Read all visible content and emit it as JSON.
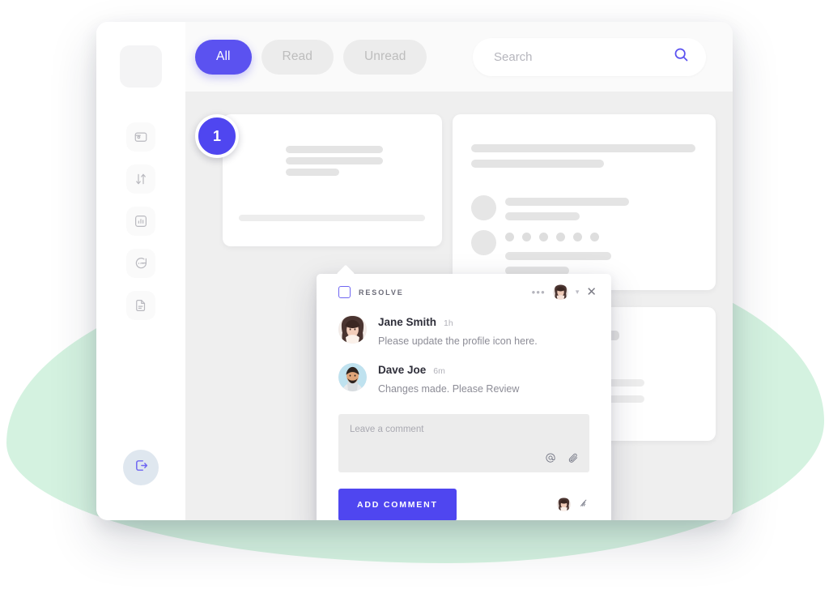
{
  "theme": {
    "accent": "#5b52f0",
    "accent_dark": "#4f46f0",
    "blob_green": "#d4f2e0",
    "canvas_gray": "#efefef",
    "skeleton_gray": "#e4e4e4"
  },
  "sidebar": {
    "logo_name": "app-logo-placeholder",
    "items": [
      {
        "icon": "wallet-icon"
      },
      {
        "icon": "transfer-arrows-icon"
      },
      {
        "icon": "bar-chart-icon"
      },
      {
        "icon": "chat-bubble-icon"
      },
      {
        "icon": "document-icon"
      }
    ],
    "logout": {
      "icon": "logout-icon"
    }
  },
  "topbar": {
    "filters": [
      {
        "label": "All",
        "active": true
      },
      {
        "label": "Read",
        "active": false
      },
      {
        "label": "Unread",
        "active": false
      }
    ],
    "search": {
      "value": "",
      "placeholder": "Search",
      "icon": "search-icon"
    }
  },
  "canvas": {
    "pin_badge": "1",
    "cards": [
      {
        "name": "card-left"
      },
      {
        "name": "card-right"
      },
      {
        "name": "card-bottom"
      }
    ]
  },
  "popover": {
    "resolve_label": "RESOLVE",
    "resolve_checked": false,
    "menu_icon": "ellipsis-icon",
    "avatar_icon": "avatar",
    "chevron_icon": "chevron-down-icon",
    "close_icon": "close-icon",
    "messages": [
      {
        "author": "Jane Smith",
        "time": "1h",
        "text": "Please update the profile icon here.",
        "avatar": "avatar-jane-smith"
      },
      {
        "author": "Dave Joe",
        "time": "6m",
        "text": "Changes made. Please Review",
        "avatar": "avatar-dave-joe"
      }
    ],
    "composer": {
      "value": "",
      "placeholder": "Leave a comment",
      "mention_icon": "at-mention-icon",
      "attach_icon": "paperclip-icon"
    },
    "submit_label": "ADD COMMENT",
    "footer": {
      "avatar": "avatar-current-user",
      "broadcast_icon": "broadcast-icon"
    }
  }
}
